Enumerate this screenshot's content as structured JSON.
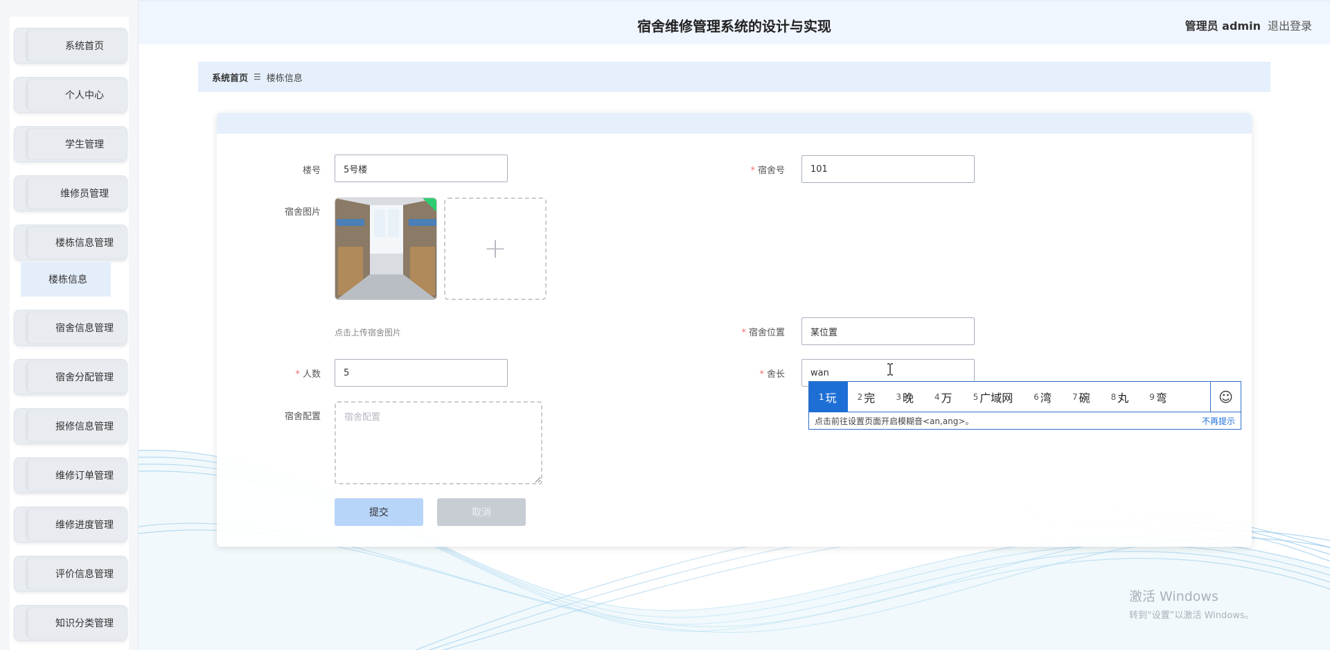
{
  "header": {
    "title": "宿舍维修管理系统的设计与实现",
    "role": "管理员 admin",
    "logout": "退出登录"
  },
  "sidebar": {
    "items": [
      {
        "label": "系统首页"
      },
      {
        "label": "个人中心"
      },
      {
        "label": "学生管理"
      },
      {
        "label": "维修员管理"
      },
      {
        "label": "楼栋信息管理"
      },
      {
        "label": "宿舍信息管理"
      },
      {
        "label": "宿舍分配管理"
      },
      {
        "label": "报修信息管理"
      },
      {
        "label": "维修订单管理"
      },
      {
        "label": "维修进度管理"
      },
      {
        "label": "评价信息管理"
      },
      {
        "label": "知识分类管理"
      }
    ],
    "submenu_active": "楼栋信息"
  },
  "breadcrumb": {
    "home": "系统首页",
    "separator": "☰",
    "current": "楼栋信息"
  },
  "form": {
    "building_label": "楼号",
    "building_value": "5号楼",
    "dorm_no_label": "宿舍号",
    "dorm_no_value": "101",
    "photo_label": "宿舍图片",
    "upload_plus": "+",
    "upload_hint": "点击上传宿舍图片",
    "location_label": "宿舍位置",
    "location_value": "某位置",
    "count_label": "人数",
    "count_value": "5",
    "leader_label": "舍长",
    "leader_value": "wan",
    "config_label": "宿舍配置",
    "config_placeholder": "宿舍配置",
    "required_mark": "*",
    "submit": "提交",
    "cancel": "取消"
  },
  "ime": {
    "candidates": [
      {
        "num": "1",
        "text": "玩"
      },
      {
        "num": "2",
        "text": "完"
      },
      {
        "num": "3",
        "text": "晚"
      },
      {
        "num": "4",
        "text": "万"
      },
      {
        "num": "5",
        "text": "广域网"
      },
      {
        "num": "6",
        "text": "湾"
      },
      {
        "num": "7",
        "text": "碗"
      },
      {
        "num": "8",
        "text": "丸"
      },
      {
        "num": "9",
        "text": "弯"
      }
    ],
    "emoji": "☺",
    "hint": "点击前往设置页面开启模糊音<an,ang>。",
    "dismiss": "不再提示"
  },
  "watermark": {
    "line1": "激活 Windows",
    "line2": "转到“设置”以激活 Windows。"
  },
  "colors": {
    "accent": "#1d6fd6",
    "header_bg": "#f0f6ff",
    "required": "#f56c6c",
    "submit_bg": "#b7d4f9"
  }
}
